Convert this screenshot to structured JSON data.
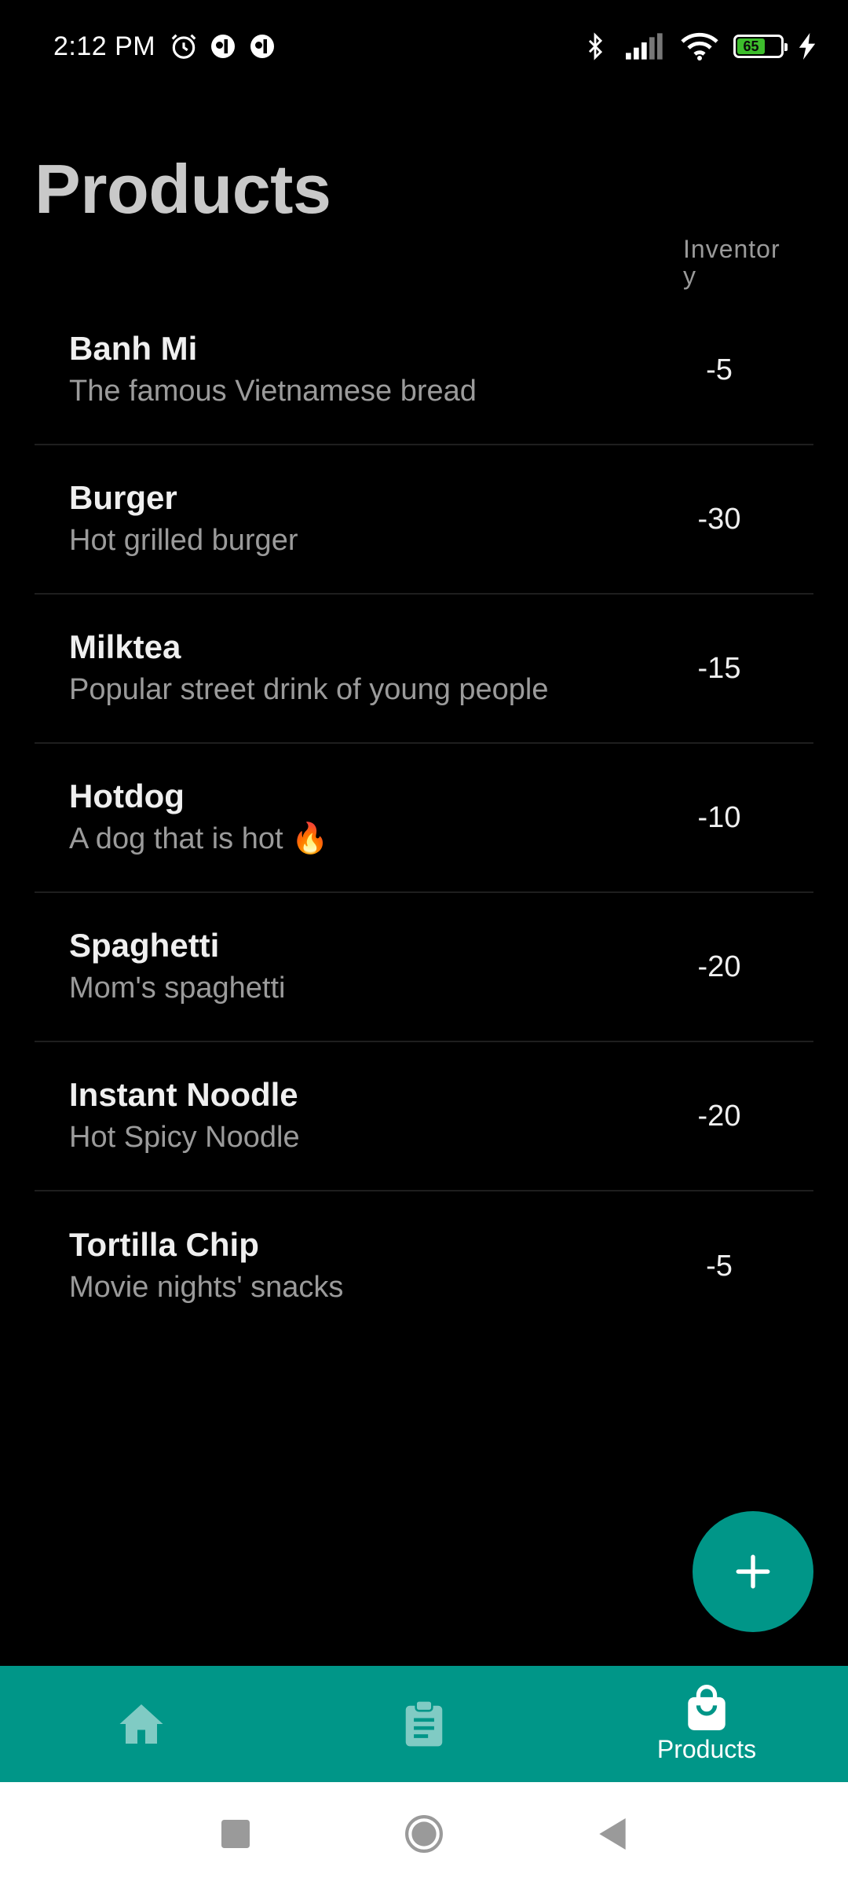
{
  "status_bar": {
    "time": "2:12 PM",
    "battery_level": "65",
    "icons": [
      "alarm-icon",
      "app-notification-icon",
      "app-notification-icon",
      "bluetooth-icon",
      "signal-icon",
      "wifi-icon",
      "battery-icon",
      "charging-icon"
    ]
  },
  "header": {
    "title": "Products",
    "inventory_label": "Inventory"
  },
  "products": [
    {
      "name": "Banh Mi",
      "description": "The famous Vietnamese bread",
      "inventory": "-5"
    },
    {
      "name": "Burger",
      "description": "Hot grilled burger",
      "inventory": "-30"
    },
    {
      "name": "Milktea",
      "description": "Popular street drink of young people",
      "inventory": "-15"
    },
    {
      "name": "Hotdog",
      "description": "A dog that is hot 🔥",
      "inventory": "-10"
    },
    {
      "name": "Spaghetti",
      "description": "Mom's spaghetti",
      "inventory": "-20"
    },
    {
      "name": "Instant Noodle",
      "description": "Hot Spicy Noodle",
      "inventory": "-20"
    },
    {
      "name": "Tortilla Chip",
      "description": "Movie nights' snacks",
      "inventory": "-5"
    }
  ],
  "fab": {
    "icon": "plus-icon"
  },
  "bottom_nav": {
    "items": [
      {
        "icon": "home-icon",
        "label": ""
      },
      {
        "icon": "clipboard-icon",
        "label": ""
      },
      {
        "icon": "shopping-bag-icon",
        "label": "Products"
      }
    ]
  },
  "colors": {
    "accent": "#009688",
    "background": "#000000",
    "title": "#c9c9c9",
    "secondary_text": "#9b9b9b",
    "inactive_nav_icon": "#80cbc4"
  }
}
